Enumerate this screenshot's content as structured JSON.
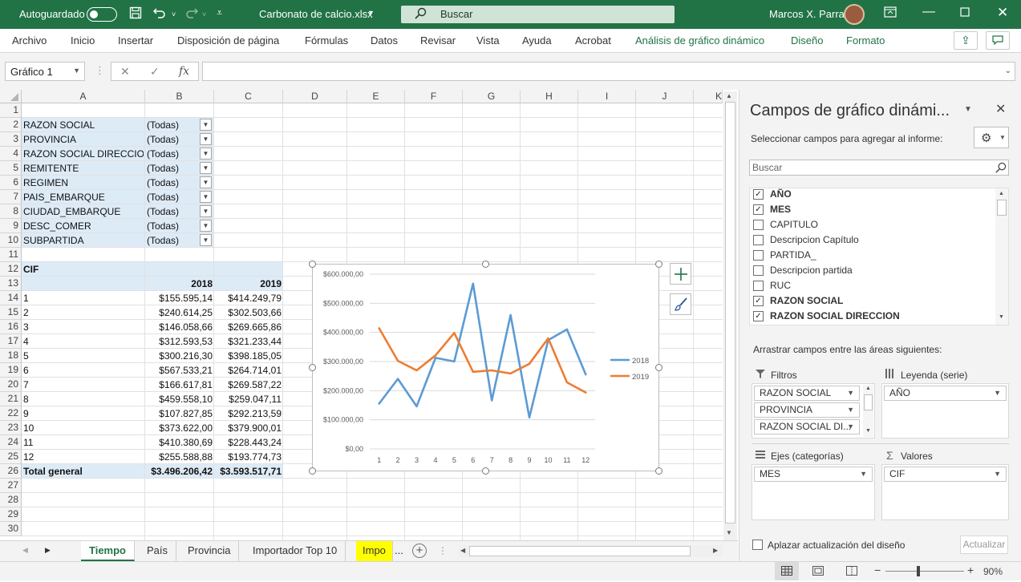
{
  "titlebar": {
    "autosave_label": "Autoguardado",
    "filename": "Carbonato de calcio.xlsx",
    "search_placeholder": "Buscar",
    "user_name": "Marcos X. Parra"
  },
  "ribbon": {
    "tabs": [
      "Archivo",
      "Inicio",
      "Insertar",
      "Disposición de página",
      "Fórmulas",
      "Datos",
      "Revisar",
      "Vista",
      "Ayuda",
      "Acrobat",
      "Análisis de gráfico dinámico",
      "Diseño",
      "Formato"
    ]
  },
  "formula_bar": {
    "name_box": "Gráfico 1",
    "fx_label": "fx",
    "value": ""
  },
  "grid": {
    "columns": [
      "A",
      "B",
      "C",
      "D",
      "E",
      "F",
      "G",
      "H",
      "I",
      "J",
      "K"
    ],
    "rows": [
      "1",
      "2",
      "3",
      "4",
      "5",
      "6",
      "7",
      "8",
      "9",
      "10",
      "11",
      "12",
      "13",
      "14",
      "15",
      "16",
      "17",
      "18",
      "19",
      "20",
      "21",
      "22",
      "23",
      "24",
      "25",
      "26",
      "27",
      "28",
      "29",
      "30"
    ],
    "filters": [
      {
        "field": "RAZON SOCIAL",
        "value": "(Todas)"
      },
      {
        "field": "PROVINCIA",
        "value": "(Todas)"
      },
      {
        "field": "RAZON SOCIAL DIRECCION",
        "value": "(Todas)"
      },
      {
        "field": "REMITENTE",
        "value": "(Todas)"
      },
      {
        "field": "REGIMEN",
        "value": "(Todas)"
      },
      {
        "field": "PAIS_EMBARQUE",
        "value": "(Todas)"
      },
      {
        "field": "CIUDAD_EMBARQUE",
        "value": "(Todas)"
      },
      {
        "field": "DESC_COMER",
        "value": "(Todas)"
      },
      {
        "field": "SUBPARTIDA",
        "value": "(Todas)"
      }
    ],
    "pivot": {
      "value_label": "CIF",
      "year_headers": [
        "2018",
        "2019"
      ],
      "rows": [
        {
          "label": "1",
          "v2018": "$155.595,14",
          "v2019": "$414.249,79"
        },
        {
          "label": "2",
          "v2018": "$240.614,25",
          "v2019": "$302.503,66"
        },
        {
          "label": "3",
          "v2018": "$146.058,66",
          "v2019": "$269.665,86"
        },
        {
          "label": "4",
          "v2018": "$312.593,53",
          "v2019": "$321.233,44"
        },
        {
          "label": "5",
          "v2018": "$300.216,30",
          "v2019": "$398.185,05"
        },
        {
          "label": "6",
          "v2018": "$567.533,21",
          "v2019": "$264.714,01"
        },
        {
          "label": "7",
          "v2018": "$166.617,81",
          "v2019": "$269.587,22"
        },
        {
          "label": "8",
          "v2018": "$459.558,10",
          "v2019": "$259.047,11"
        },
        {
          "label": "9",
          "v2018": "$107.827,85",
          "v2019": "$292.213,59"
        },
        {
          "label": "10",
          "v2018": "$373.622,00",
          "v2019": "$379.900,01"
        },
        {
          "label": "11",
          "v2018": "$410.380,69",
          "v2019": "$228.443,24"
        },
        {
          "label": "12",
          "v2018": "$255.588,88",
          "v2019": "$193.774,73"
        }
      ],
      "total": {
        "label": "Total general",
        "v2018": "$3.496.206,42",
        "v2019": "$3.593.517,71"
      }
    }
  },
  "chart_data": {
    "type": "line",
    "x": [
      "1",
      "2",
      "3",
      "4",
      "5",
      "6",
      "7",
      "8",
      "9",
      "10",
      "11",
      "12"
    ],
    "series": [
      {
        "name": "2018",
        "color": "#5b9bd5",
        "values": [
          155595.14,
          240614.25,
          146058.66,
          312593.53,
          300216.3,
          567533.21,
          166617.81,
          459558.1,
          107827.85,
          373622.0,
          410380.69,
          255588.88
        ]
      },
      {
        "name": "2019",
        "color": "#ed7d31",
        "values": [
          414249.79,
          302503.66,
          269665.86,
          321233.44,
          398185.05,
          264714.01,
          269587.22,
          259047.11,
          292213.59,
          379900.01,
          228443.24,
          193774.73
        ]
      }
    ],
    "ylim": [
      0,
      600000
    ],
    "yticks": [
      "$0,00",
      "$100.000,00",
      "$200.000,00",
      "$300.000,00",
      "$400.000,00",
      "$500.000,00",
      "$600.000,00"
    ],
    "grid": true,
    "legend": "right"
  },
  "sheet_tabs": [
    "Tiempo",
    "País",
    "Provincia",
    "Importador Top 10",
    "Impo",
    "..."
  ],
  "pivot_pane": {
    "title": "Campos de gráfico dinámi...",
    "subtitle": "Seleccionar campos para agregar al informe:",
    "search_placeholder": "Buscar",
    "fields": [
      {
        "name": "AÑO",
        "checked": "✓",
        "bold": true
      },
      {
        "name": "MES",
        "checked": "✓",
        "bold": true
      },
      {
        "name": "CAPITULO",
        "checked": "",
        "bold": false
      },
      {
        "name": "Descripcion Capítulo",
        "checked": "",
        "bold": false
      },
      {
        "name": "PARTIDA_",
        "checked": "",
        "bold": false
      },
      {
        "name": "Descripcion partida",
        "checked": "",
        "bold": false
      },
      {
        "name": "RUC",
        "checked": "",
        "bold": false
      },
      {
        "name": "RAZON SOCIAL",
        "checked": "✓",
        "bold": true
      },
      {
        "name": "RAZON SOCIAL DIRECCION",
        "checked": "✓",
        "bold": true
      }
    ],
    "drag_label": "Arrastrar campos entre las áreas siguientes:",
    "filters_label": "Filtros",
    "filters_items": [
      "RAZON SOCIAL",
      "PROVINCIA",
      "RAZON SOCIAL DI..."
    ],
    "legend_label": "Leyenda (serie)",
    "legend_items": [
      "AÑO"
    ],
    "axes_label": "Ejes (categorías)",
    "axes_items": [
      "MES"
    ],
    "values_label": "Valores",
    "values_items": [
      "CIF"
    ],
    "defer_label": "Aplazar actualización del diseño",
    "update_label": "Actualizar"
  },
  "statusbar": {
    "zoom": "90%"
  }
}
